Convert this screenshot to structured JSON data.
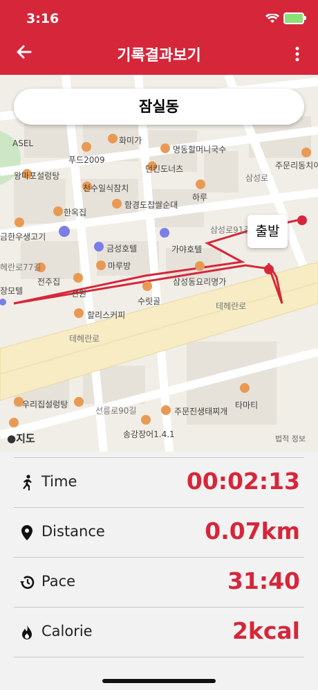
{
  "status_bar": {
    "time": "3:16"
  },
  "header": {
    "title": "기록결과보기"
  },
  "map": {
    "location": "잠실동",
    "start_marker": "출발",
    "attribution": "지도",
    "legal": "법적 정보",
    "route_color": "#d6263a",
    "labels": [
      "ASEL",
      "화미가",
      "푸드2009",
      "명동할머니국수",
      "주문리동치이",
      "왕마포설렁탕",
      "던킨도너츠",
      "천수일식참치",
      "하루",
      "한옥집",
      "함경도찹쌀순대",
      "금한우생고기",
      "금성호텔",
      "가야호텔",
      "헤란로77길",
      "마루방",
      "전주집",
      "삼성동요리명가",
      "장모텔",
      "선원",
      "수릿골",
      "할리스커피",
      "테헤란로",
      "테헤란로",
      "우리집설렁탕",
      "선릉로90길",
      "타마티",
      "주문진생태찌개",
      "송강장어1.4.1",
      "삼성로91길",
      "삼성로"
    ]
  },
  "stats": [
    {
      "icon": "running-icon",
      "label": "Time",
      "value": "00:02:13"
    },
    {
      "icon": "location-pin-icon",
      "label": "Distance",
      "value": "0.07km"
    },
    {
      "icon": "history-icon",
      "label": "Pace",
      "value": "31:40"
    },
    {
      "icon": "flame-icon",
      "label": "Calorie",
      "value": "2kcal"
    }
  ]
}
